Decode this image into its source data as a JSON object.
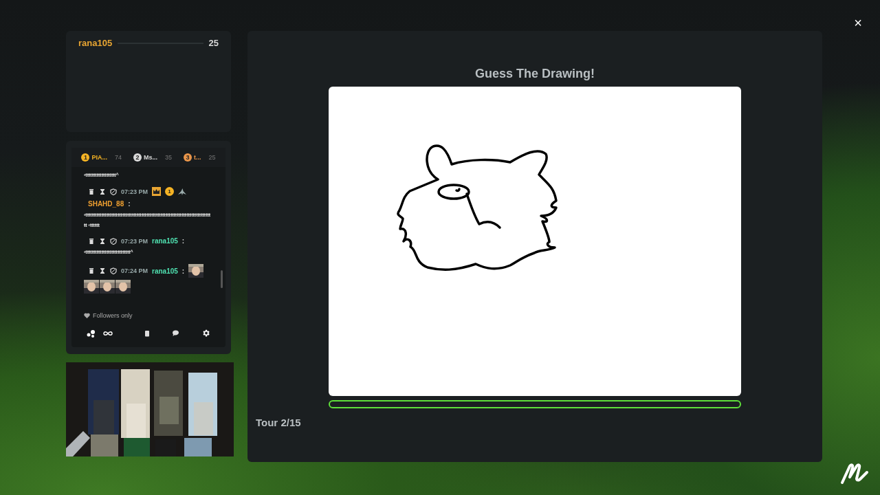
{
  "close_button": "×",
  "leaderboard": {
    "players": [
      {
        "name": "rana105",
        "score": "25"
      }
    ]
  },
  "chat": {
    "top_players": [
      {
        "rank": "1",
        "name": "PIA...",
        "score": "74",
        "color": "#f5b324"
      },
      {
        "rank": "2",
        "name": "Ms...",
        "score": "35",
        "color": "#d9d9d9"
      },
      {
        "rank": "3",
        "name": "t...",
        "score": "25",
        "color": "#e8954a"
      }
    ],
    "messages": [
      {
        "kind": "continuation",
        "text": "‹ŧŧŧŧŧŧŧŧŧŧŧŧŧŧŧŧŧŧŧ^"
      },
      {
        "kind": "message",
        "time": "07:23 PM",
        "user": "SHAHD_88",
        "colon": ":",
        "color": "#f0a030",
        "badge": "1",
        "text": "‹ŧŧŧŧŧŧŧŧŧŧŧŧŧŧŧŧŧŧŧŧŧŧŧŧŧŧŧŧŧŧŧŧŧŧŧŧŧŧŧŧŧŧŧŧŧŧŧŧŧŧŧŧŧŧŧŧŧŧŧŧŧŧŧŧŧŧŧŧŧŧŧŧŧŧŧŧŧŧŧŧ ‹ŧŧŧŧŧŧ"
      },
      {
        "kind": "message",
        "time": "07:23 PM",
        "user": "rana105",
        "colon": ":",
        "color": "#4fe0b0",
        "text": "‹ŧŧŧŧŧŧŧŧŧŧŧŧŧŧŧŧŧŧŧŧŧŧŧŧŧŧŧŧ^"
      },
      {
        "kind": "emotes",
        "time": "07:24 PM",
        "user": "rana105",
        "colon": ":",
        "color": "#4fe0b0"
      }
    ],
    "followers_only": "Followers only"
  },
  "game": {
    "title": "Guess The Drawing!",
    "timer": {
      "level": 0
    },
    "round": "Tour 2/15"
  }
}
